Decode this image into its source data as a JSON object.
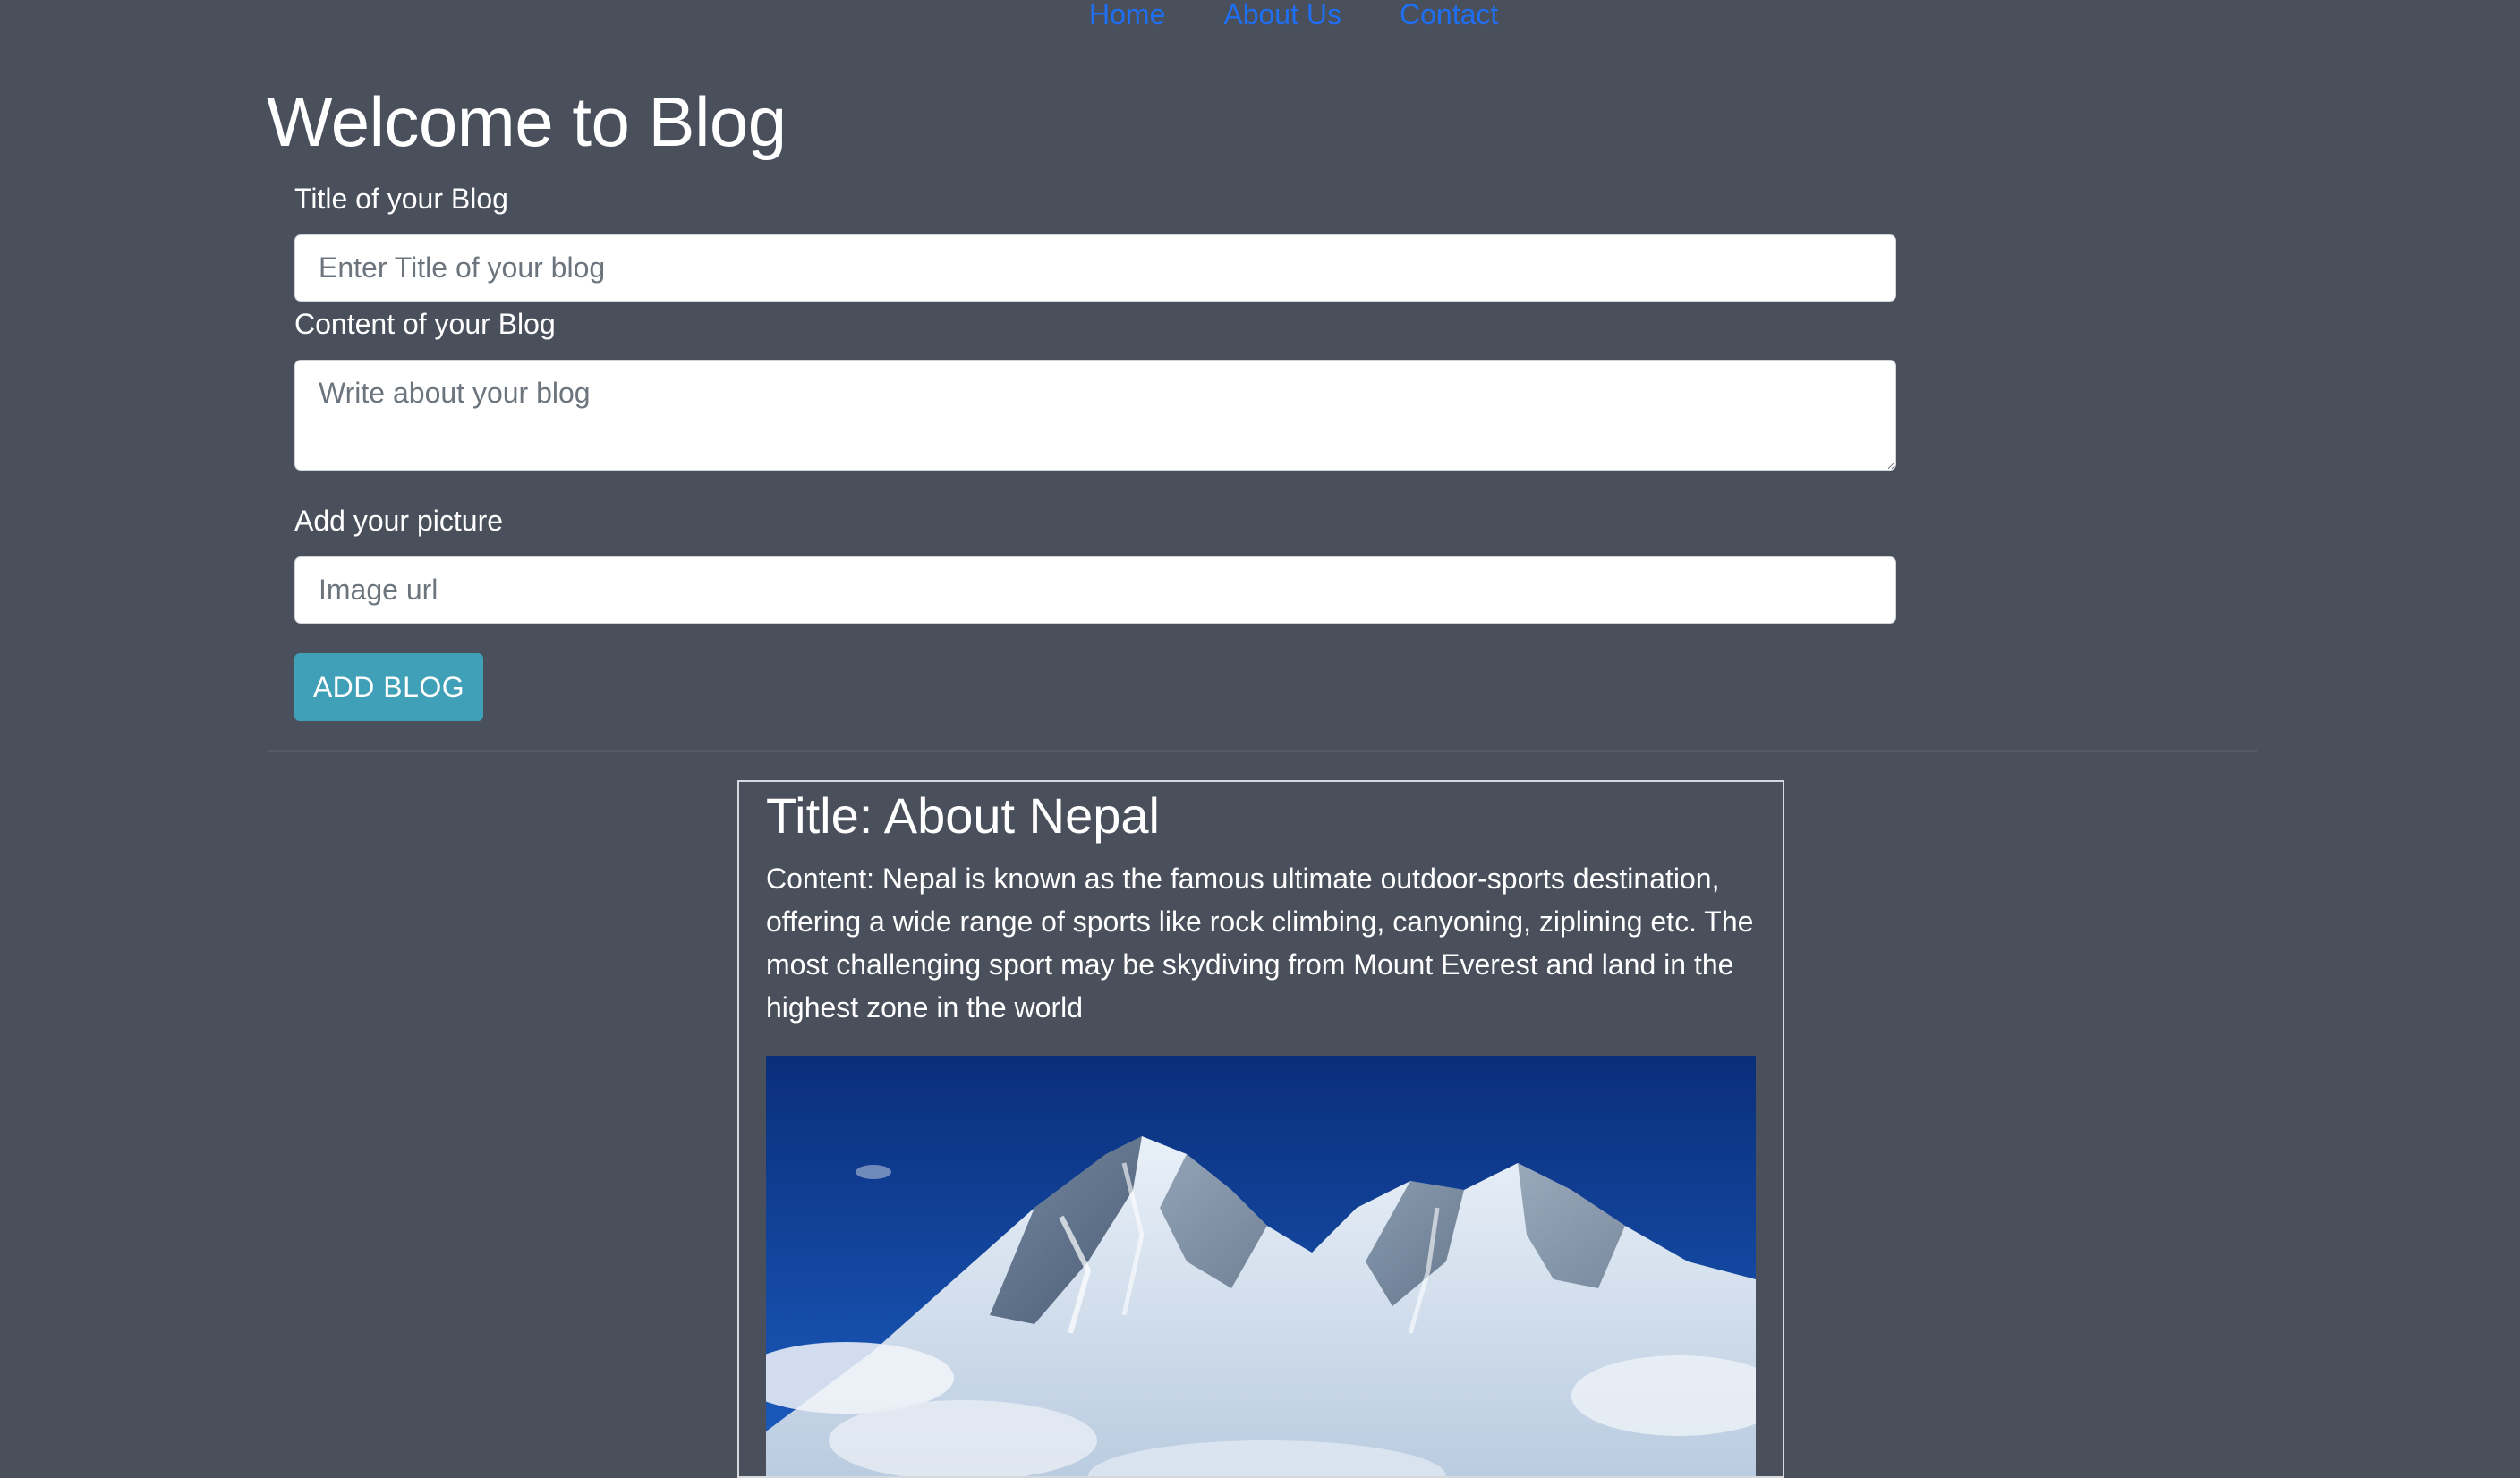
{
  "nav": {
    "items": [
      {
        "label": "Home"
      },
      {
        "label": "About Us"
      },
      {
        "label": "Contact"
      }
    ]
  },
  "page": {
    "title": "Welcome to Blog"
  },
  "form": {
    "title_label": "Title of your Blog",
    "title_placeholder": "Enter Title of your blog",
    "title_value": "",
    "content_label": "Content of your Blog",
    "content_placeholder": "Write about your blog",
    "content_value": "",
    "picture_label": "Add your picture",
    "picture_placeholder": "Image url",
    "picture_value": "",
    "submit_label": "ADD BLOG"
  },
  "blogs": [
    {
      "title": "Title: About Nepal",
      "content": "Content: Nepal is known as the famous ultimate outdoor-sports destination, offering a wide range of sports like rock climbing, canyoning, ziplining etc. The most challenging sport may be skydiving from Mount Everest and land in the highest zone in the world",
      "image_subject": "snow-covered mountain peak against deep blue sky"
    }
  ],
  "colors": {
    "background": "#4a4f5c",
    "link": "#1e6ff2",
    "button": "#3fa0b8",
    "card_border": "#d5d8dd"
  }
}
